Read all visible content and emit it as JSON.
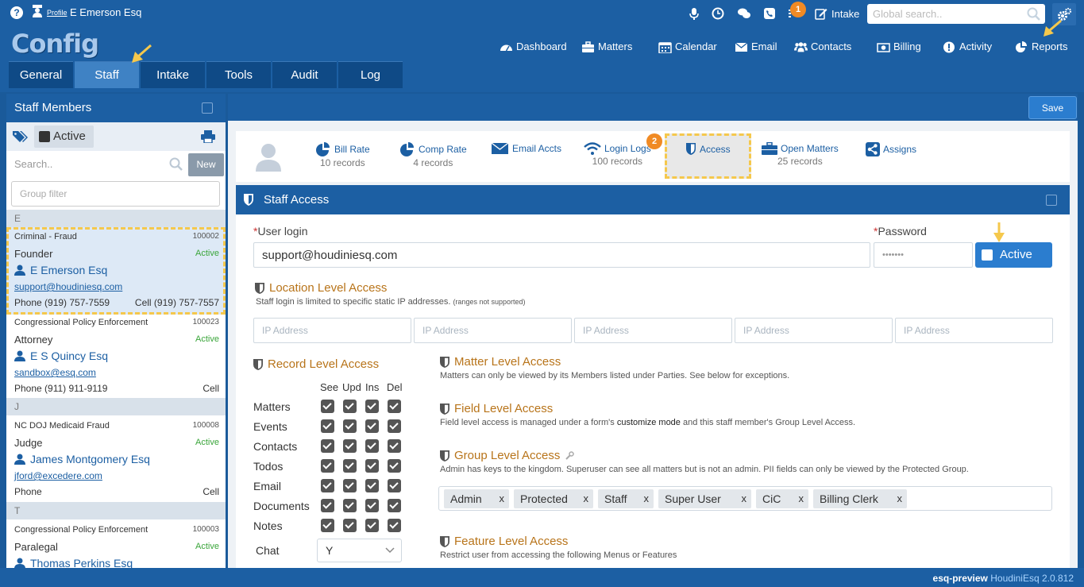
{
  "topbar": {
    "help": "?",
    "profile_link": "Profile",
    "profile_name": "E Emerson Esq",
    "notifications_count": "1",
    "intake_label": "Intake",
    "search_placeholder": "Global search.."
  },
  "header": {
    "app_title": "Config",
    "nav": [
      {
        "label": "Dashboard",
        "icon": "dashboard-icon"
      },
      {
        "label": "Matters",
        "icon": "briefcase-icon"
      },
      {
        "label": "Calendar",
        "icon": "calendar-icon"
      },
      {
        "label": "Email",
        "icon": "envelope-icon"
      },
      {
        "label": "Contacts",
        "icon": "users-icon"
      },
      {
        "label": "Billing",
        "icon": "money-icon"
      },
      {
        "label": "Activity",
        "icon": "alert-icon"
      },
      {
        "label": "Reports",
        "icon": "pie-chart-icon"
      }
    ],
    "tabs": [
      "General",
      "Staff",
      "Intake",
      "Tools",
      "Audit",
      "Log"
    ],
    "active_tab": "Staff"
  },
  "left_panel": {
    "title": "Staff Members",
    "active_filter": "Active",
    "search_placeholder": "Search..",
    "new_button": "New",
    "group_filter_placeholder": "Group filter",
    "groups": [
      {
        "letter": "E",
        "staff": [
          {
            "dept": "Criminal - Fraud",
            "id": "100002",
            "role": "Founder",
            "status": "Active",
            "name": "E Emerson Esq",
            "email": "support@houdiniesq.com",
            "phone": "Phone (919) 757-7559",
            "cell": "Cell (919) 757-7557",
            "selected": true
          },
          {
            "dept": "Congressional Policy Enforcement",
            "id": "100023",
            "role": "Attorney",
            "status": "Active",
            "name": "E S Quincy Esq",
            "email": "sandbox@esq.com",
            "phone": "Phone (911) 911-9119",
            "cell": "Cell"
          }
        ]
      },
      {
        "letter": "J",
        "staff": [
          {
            "dept": "NC DOJ Medicaid Fraud",
            "id": "100008",
            "role": "Judge",
            "status": "Active",
            "name": "James Montgomery Esq",
            "email": "jford@excedere.com",
            "phone": "Phone",
            "cell": "Cell"
          }
        ]
      },
      {
        "letter": "T",
        "staff": [
          {
            "dept": "Congressional Policy Enforcement",
            "id": "100003",
            "role": "Paralegal",
            "status": "Active",
            "name": "Thomas Perkins Esq"
          }
        ]
      }
    ]
  },
  "right_panel": {
    "save_button": "Save",
    "step_badge": "2",
    "subtabs": [
      {
        "label": "Bill Rate",
        "sub": "10 records"
      },
      {
        "label": "Comp Rate",
        "sub": "4 records"
      },
      {
        "label": "Email Accts",
        "sub": ""
      },
      {
        "label": "Login Logs",
        "sub": "100 records"
      },
      {
        "label": "Access",
        "sub": ""
      },
      {
        "label": "Open Matters",
        "sub": "25 records"
      },
      {
        "label": "Assigns",
        "sub": ""
      }
    ],
    "section_title": "Staff Access",
    "user_login_label": "User login",
    "user_login_value": "support@houdiniesq.com",
    "password_label": "Password",
    "password_value": "•••••••",
    "active_button": "Active",
    "location": {
      "title": "Location Level Access",
      "desc": "Staff login is limited to specific static IP addresses.",
      "desc_small": "(ranges not supported)",
      "ip_placeholder": "IP Address"
    },
    "record": {
      "title": "Record Level Access",
      "columns": [
        "See",
        "Upd",
        "Ins",
        "Del"
      ],
      "rows": [
        "Matters",
        "Events",
        "Contacts",
        "Todos",
        "Email",
        "Documents",
        "Notes"
      ],
      "chat_label": "Chat",
      "chat_value": "Y"
    },
    "matter": {
      "title": "Matter Level Access",
      "desc": "Matters can only be viewed by its Members listed under Parties. See below for exceptions."
    },
    "field": {
      "title": "Field Level Access",
      "desc_pre": "Field level access is managed under a form's",
      "desc_link": "customize mode",
      "desc_post": "and this staff member's Group Level Access."
    },
    "group": {
      "title": "Group Level Access",
      "desc": "Admin has keys to the kingdom. Superuser can see all matters but is not an admin. PII fields can only be viewed by the Protected Group.",
      "chips": [
        "Admin",
        "Protected",
        "Staff",
        "Super User",
        "CiC",
        "Billing Clerk"
      ],
      "chip_remove": "x"
    },
    "feature": {
      "title": "Feature Level Access",
      "desc": "Restrict user from accessing the following Menus or Features"
    }
  },
  "footer": {
    "env": "esq-preview",
    "product": "HoudiniEsq 2.0.812"
  },
  "colors": {
    "primary": "#1c5fa3",
    "accent_orange": "#f08a24",
    "highlight": "#f5c84c",
    "section_heading": "#b8741a",
    "active_green": "#3aa53a"
  }
}
